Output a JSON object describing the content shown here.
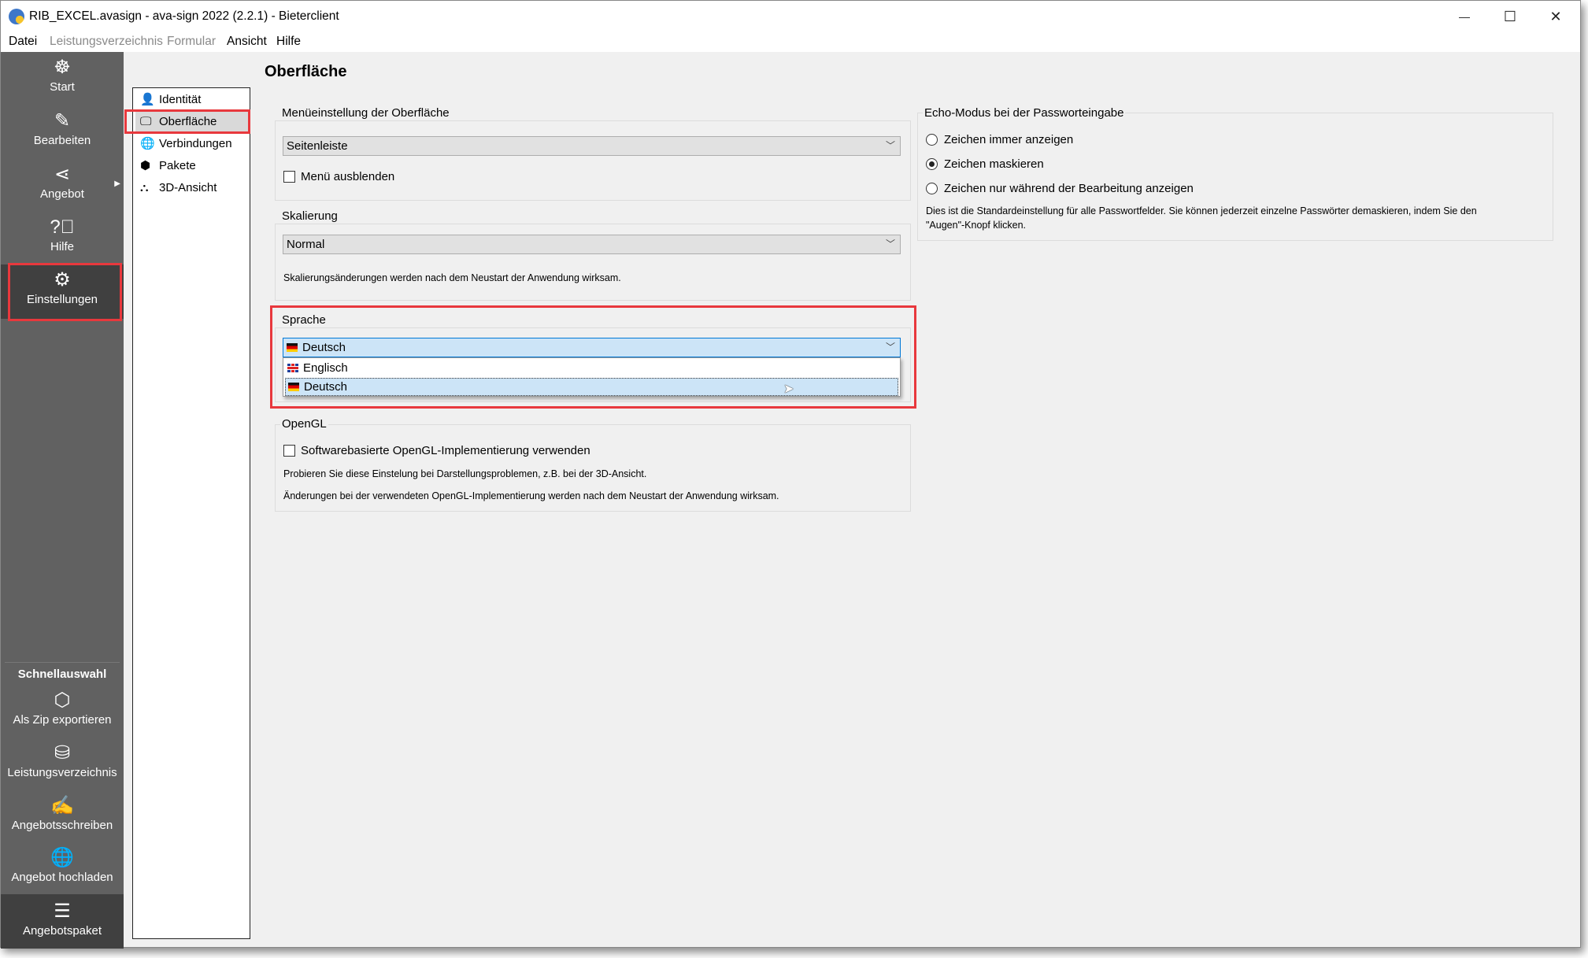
{
  "window": {
    "title": "RIB_EXCEL.avasign - ava-sign 2022 (2.2.1) - Bieterclient",
    "minimize": "—",
    "maximize": "☐",
    "close": "✕"
  },
  "menu": [
    {
      "label": "Datei",
      "enabled": true
    },
    {
      "label": "Leistungsverzeichnis",
      "enabled": false
    },
    {
      "label": "Formular",
      "enabled": false
    },
    {
      "label": "Ansicht",
      "enabled": true
    },
    {
      "label": "Hilfe",
      "enabled": true
    }
  ],
  "sidebar": {
    "items": [
      {
        "label": "Start",
        "icon": "helm-icon"
      },
      {
        "label": "Bearbeiten",
        "icon": "pencil-icon"
      },
      {
        "label": "Angebot",
        "icon": "share-icon"
      },
      {
        "label": "Hilfe",
        "icon": "help-icon"
      },
      {
        "label": "Einstellungen",
        "icon": "gear-icon",
        "selected": true
      }
    ],
    "quick_title": "Schnellauswahl",
    "quick": [
      {
        "label": "Als Zip exportieren",
        "icon": "package-export-icon"
      },
      {
        "label": "Leistungsverzeichnis",
        "icon": "coins-icon"
      },
      {
        "label": "Angebotsschreiben",
        "icon": "document-sign-icon"
      },
      {
        "label": "Angebot hochladen",
        "icon": "globe-upload-icon"
      },
      {
        "label": "Angebotspaket",
        "icon": "tree-list-icon",
        "selected": true
      }
    ]
  },
  "settings_nav": [
    {
      "label": "Identität",
      "icon": "user-icon"
    },
    {
      "label": "Oberfläche",
      "icon": "monitor-icon",
      "selected": true
    },
    {
      "label": "Verbindungen",
      "icon": "globe-icon"
    },
    {
      "label": "Pakete",
      "icon": "cube-icon"
    },
    {
      "label": "3D-Ansicht",
      "icon": "3d-icon"
    }
  ],
  "page_title": "Oberfläche",
  "menu_group": {
    "label": "Menüeinstellung der Oberfläche",
    "value": "Seitenleiste",
    "hide_menu": "Menü ausblenden",
    "hide_menu_checked": false
  },
  "scale_group": {
    "label": "Skalierung",
    "value": "Normal",
    "note": "Skalierungsänderungen werden nach dem Neustart der Anwendung wirksam."
  },
  "language_group": {
    "label": "Sprache",
    "value": "Deutsch",
    "options": [
      "Englisch",
      "Deutsch"
    ],
    "highlighted": "Deutsch"
  },
  "opengl_group": {
    "label": "OpenGL",
    "checkbox": "Softwarebasierte OpenGL-Implementierung verwenden",
    "checked": false,
    "note1": "Probieren Sie diese Einstelung bei Darstellungsproblemen, z.B. bei der 3D-Ansicht.",
    "note2": "Änderungen bei der verwendeten OpenGL-Implementierung werden nach dem Neustart der Anwendung wirksam."
  },
  "echo_group": {
    "label": "Echo-Modus bei der Passworteingabe",
    "options": [
      "Zeichen immer anzeigen",
      "Zeichen maskieren",
      "Zeichen nur während der Bearbeitung anzeigen"
    ],
    "selected": "Zeichen maskieren",
    "note1": "Dies ist die Standardeinstellung für alle Passwortfelder. Sie können jederzeit einzelne Passwörter demaskieren, indem Sie den",
    "note2": "\"Augen\"-Knopf klicken."
  },
  "colors": {
    "sidebar": "#616161",
    "sidebar_selected": "#404040",
    "highlight": "#e8383d",
    "selection": "#cce4f7"
  }
}
